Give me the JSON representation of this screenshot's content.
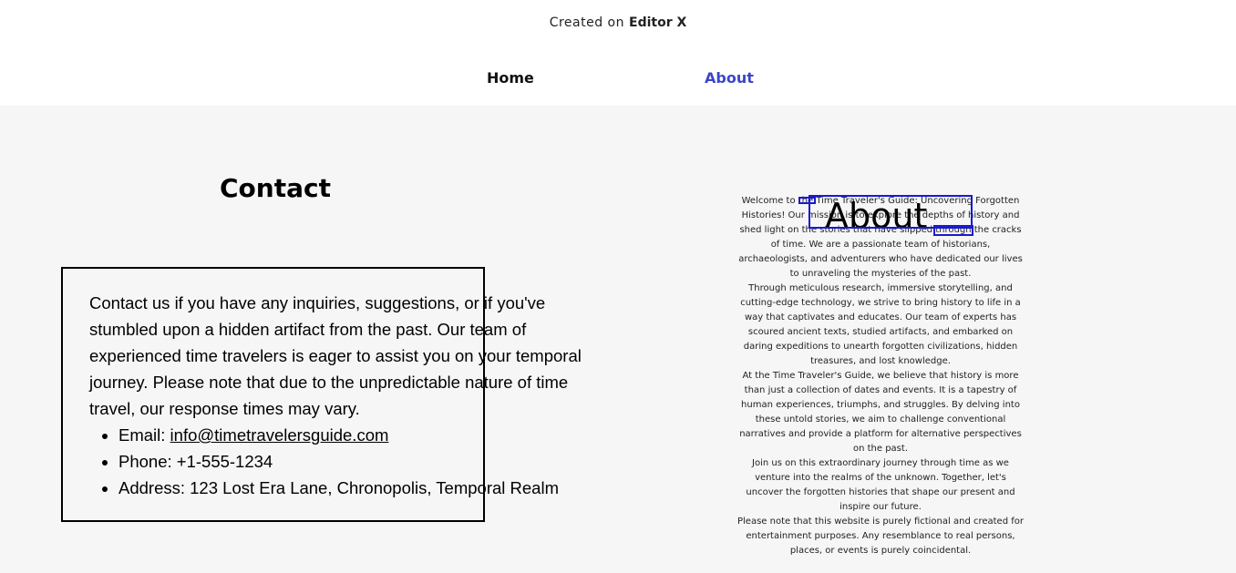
{
  "banner": {
    "prefix": "Created on",
    "brand": "Editor X"
  },
  "nav": {
    "home_label": "Home",
    "about_label": "About"
  },
  "contact": {
    "title": "Contact",
    "intro": "Contact us if you have any inquiries, suggestions, or if you've stumbled upon a hidden artifact from the past. Our team of experienced time travelers is eager to assist you on your temporal journey. Please note that due to the unpredictable nature of time travel, our response times may vary.",
    "email_label": "Email: ",
    "email_value": "info@timetravelersguide.com",
    "phone_label": "Phone: +1-555-1234",
    "address_label": "Address: 123 Lost Era Lane, Chronopolis, Temporal Realm"
  },
  "about": {
    "heading": "About",
    "paragraphs": [
      "Welcome to the Time Traveler's Guide: Uncovering Forgotten Histories! Our mission is to explore the depths of history and shed light on the stories that have slipped through the cracks of time. We are a passionate team of historians, archaeologists, and adventurers who have dedicated our lives to unraveling the mysteries of the past.",
      "Through meticulous research, immersive storytelling, and cutting-edge technology, we strive to bring history to life in a way that captivates and educates. Our team of experts has scoured ancient texts, studied artifacts, and embarked on daring expeditions to unearth forgotten civilizations, hidden treasures, and lost knowledge.",
      "At the Time Traveler's Guide, we believe that history is more than just a collection of dates and events. It is a tapestry of human experiences, triumphs, and struggles. By delving into these untold stories, we aim to challenge conventional narratives and provide a platform for alternative perspectives on the past.",
      "Join us on this extraordinary journey through time as we venture into the realms of the unknown. Together, let's uncover the forgotten histories that shape our present and inspire our future.",
      "Please note that this website is purely fictional and created for entertainment purposes. Any resemblance to real persons, places, or events is purely coincidental."
    ]
  },
  "colors": {
    "accent": "#3a46c9",
    "selection_outline": "#1a1acf",
    "page_bg": "#f6f6f6"
  }
}
